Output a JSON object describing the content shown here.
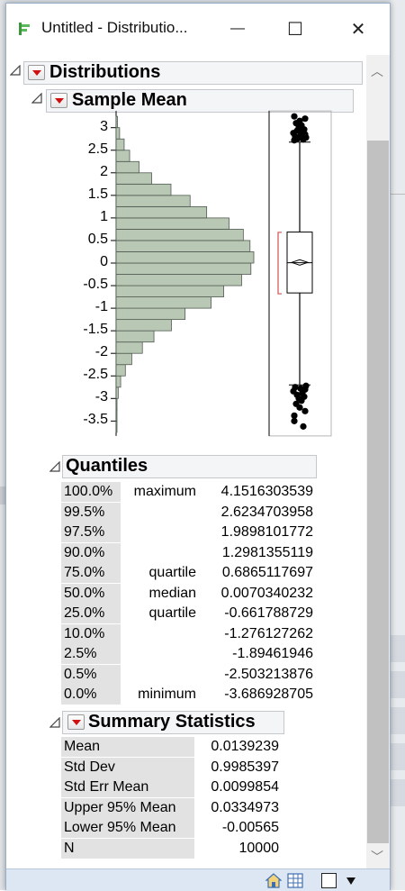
{
  "window": {
    "title": "Untitled - Distributio...",
    "minimize_glyph": "—",
    "maximize_glyph": "☐",
    "close_glyph": "✕"
  },
  "report": {
    "distributions_title": "Distributions",
    "variable_title": "Sample Mean",
    "quantiles_title": "Quantiles",
    "summary_title": "Summary Statistics"
  },
  "chart_data": {
    "type": "bar",
    "orientation": "horizontal histogram with outlier box plot",
    "y_ticks": [
      "3",
      "2.5",
      "2",
      "1.5",
      "1",
      "0.5",
      "0",
      "-0.5",
      "-1",
      "-1.5",
      "-2",
      "-2.5",
      "-3",
      "-3.5"
    ],
    "ylim": [
      -3.75,
      3.25
    ],
    "bin_width": 0.25,
    "bins": [
      {
        "lo": -3.75,
        "hi": -3.5,
        "count": 1
      },
      {
        "lo": -3.5,
        "hi": -3.25,
        "count": 3
      },
      {
        "lo": -3.25,
        "hi": -3.0,
        "count": 6
      },
      {
        "lo": -3.0,
        "hi": -2.75,
        "count": 14
      },
      {
        "lo": -2.75,
        "hi": -2.5,
        "count": 30
      },
      {
        "lo": -2.5,
        "hi": -2.25,
        "count": 61
      },
      {
        "lo": -2.25,
        "hi": -2.0,
        "count": 103
      },
      {
        "lo": -2.0,
        "hi": -1.75,
        "count": 173
      },
      {
        "lo": -1.75,
        "hi": -1.5,
        "count": 249
      },
      {
        "lo": -1.5,
        "hi": -1.25,
        "count": 364
      },
      {
        "lo": -1.25,
        "hi": -1.0,
        "count": 454
      },
      {
        "lo": -1.0,
        "hi": -0.75,
        "count": 625
      },
      {
        "lo": -0.75,
        "hi": -0.5,
        "count": 708
      },
      {
        "lo": -0.5,
        "hi": -0.25,
        "count": 826
      },
      {
        "lo": -0.25,
        "hi": 0.0,
        "count": 887
      },
      {
        "lo": 0.0,
        "hi": 0.25,
        "count": 906
      },
      {
        "lo": 0.25,
        "hi": 0.5,
        "count": 881
      },
      {
        "lo": 0.5,
        "hi": 0.75,
        "count": 837
      },
      {
        "lo": 0.75,
        "hi": 1.0,
        "count": 743
      },
      {
        "lo": 1.0,
        "hi": 1.25,
        "count": 596
      },
      {
        "lo": 1.25,
        "hi": 1.5,
        "count": 487
      },
      {
        "lo": 1.5,
        "hi": 1.75,
        "count": 361
      },
      {
        "lo": 1.75,
        "hi": 2.0,
        "count": 234
      },
      {
        "lo": 2.0,
        "hi": 2.25,
        "count": 151
      },
      {
        "lo": 2.25,
        "hi": 2.5,
        "count": 89
      },
      {
        "lo": 2.5,
        "hi": 2.75,
        "count": 53
      },
      {
        "lo": 2.75,
        "hi": 3.0,
        "count": 23
      },
      {
        "lo": 3.0,
        "hi": 3.25,
        "count": 9
      }
    ],
    "boxplot": {
      "q1": -0.661788729,
      "median": 0.0070340232,
      "q3": 0.6865117697,
      "mean": 0.0139239,
      "whisker_low": -2.7,
      "whisker_high": 2.68,
      "shortest_half": [
        -0.68,
        0.68
      ],
      "outliers_high": [
        2.72,
        2.74,
        2.76,
        2.78,
        2.8,
        2.82,
        2.85,
        2.88,
        2.9,
        2.93,
        2.96,
        3.0,
        3.05,
        3.1,
        3.15,
        3.2,
        3.25
      ],
      "outliers_low": [
        -2.72,
        -2.75,
        -2.78,
        -2.8,
        -2.84,
        -2.88,
        -2.92,
        -2.96,
        -3.0,
        -3.05,
        -3.12,
        -3.2,
        -3.28,
        -3.38,
        -3.5,
        -3.62
      ]
    },
    "colors": {
      "bar_fill": "#b9c8b5",
      "bar_stroke": "#505a50",
      "shortest_half": "#d05050"
    }
  },
  "quantiles": [
    {
      "pct": "100.0%",
      "label": "maximum",
      "value": "4.1516303539"
    },
    {
      "pct": "99.5%",
      "label": "",
      "value": "2.6234703958"
    },
    {
      "pct": "97.5%",
      "label": "",
      "value": "1.9898101772"
    },
    {
      "pct": "90.0%",
      "label": "",
      "value": "1.2981355119"
    },
    {
      "pct": "75.0%",
      "label": "quartile",
      "value": "0.6865117697"
    },
    {
      "pct": "50.0%",
      "label": "median",
      "value": "0.0070340232"
    },
    {
      "pct": "25.0%",
      "label": "quartile",
      "value": "-0.661788729"
    },
    {
      "pct": "10.0%",
      "label": "",
      "value": "-1.276127262"
    },
    {
      "pct": "2.5%",
      "label": "",
      "value": "-1.89461946"
    },
    {
      "pct": "0.5%",
      "label": "",
      "value": "-2.503213876"
    },
    {
      "pct": "0.0%",
      "label": "minimum",
      "value": "-3.686928705"
    }
  ],
  "summary": [
    {
      "label": "Mean",
      "value": "0.0139239"
    },
    {
      "label": "Std Dev",
      "value": "0.9985397"
    },
    {
      "label": "Std Err Mean",
      "value": "0.0099854"
    },
    {
      "label": "Upper 95% Mean",
      "value": "0.0334973"
    },
    {
      "label": "Lower 95% Mean",
      "value": "-0.00565"
    },
    {
      "label": "N",
      "value": "10000"
    }
  ]
}
